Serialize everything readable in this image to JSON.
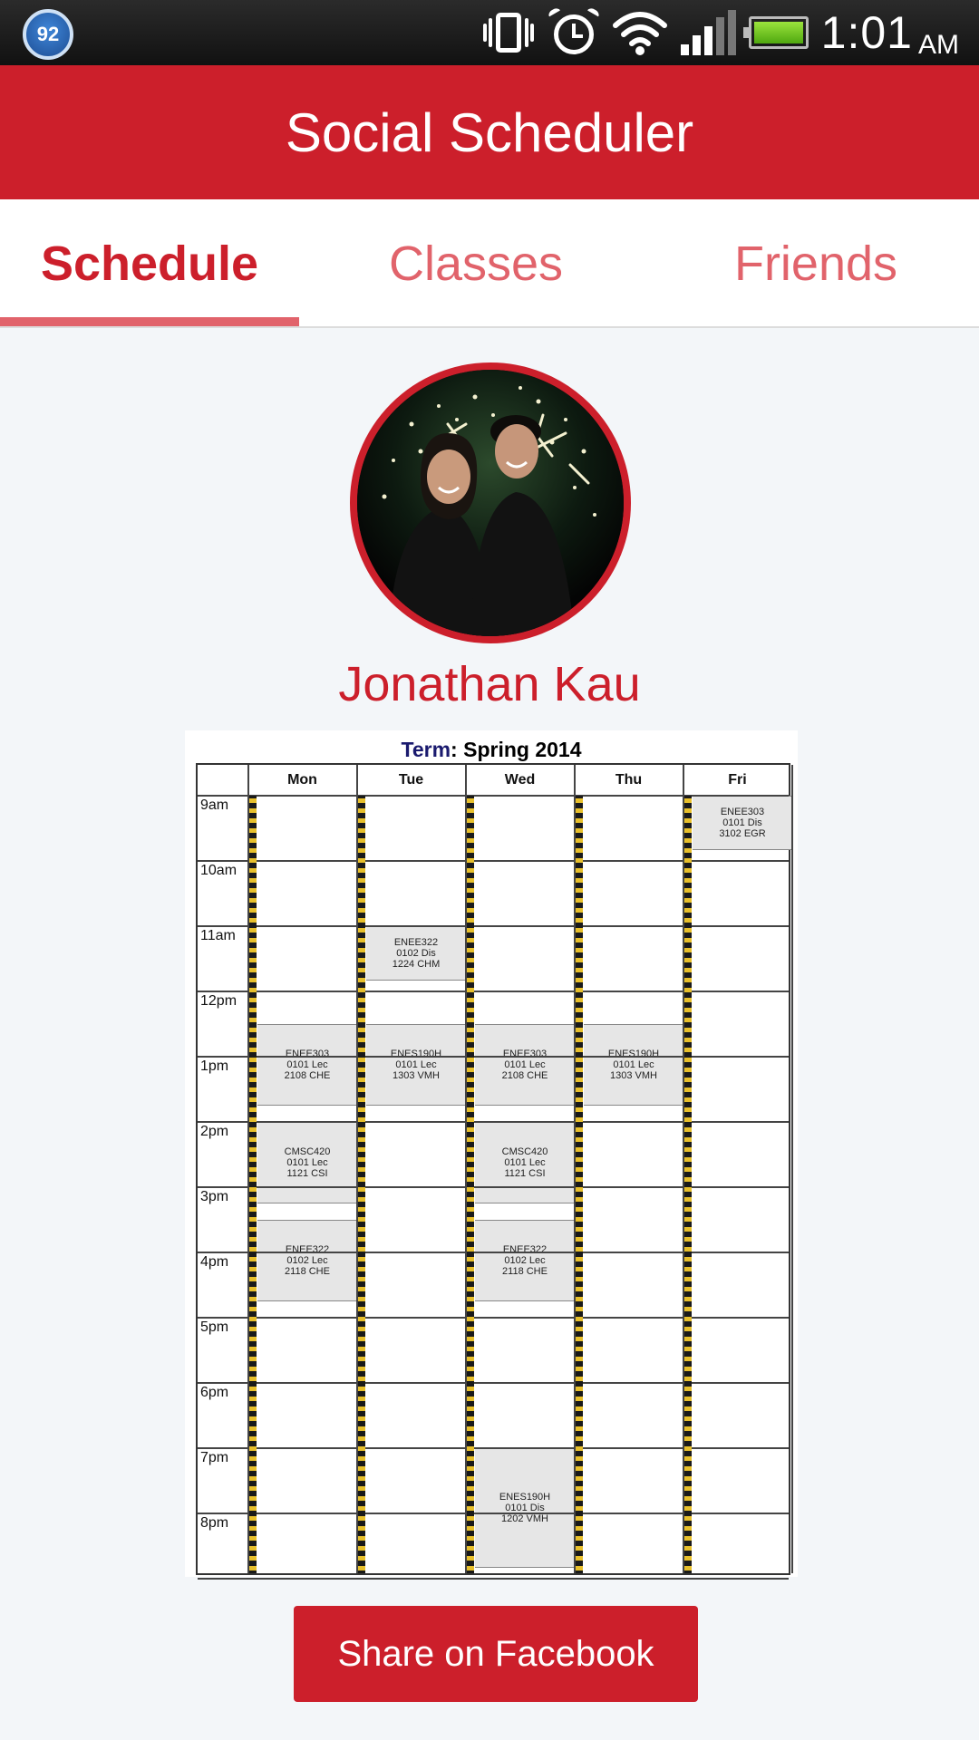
{
  "status_bar": {
    "badge": "92",
    "time": "1:01",
    "ampm": "AM",
    "icons": [
      "vibrate-icon",
      "alarm-icon",
      "wifi-icon",
      "signal-icon",
      "battery-icon"
    ]
  },
  "app": {
    "title": "Social Scheduler"
  },
  "tabs": [
    {
      "label": "Schedule",
      "active": true
    },
    {
      "label": "Classes",
      "active": false
    },
    {
      "label": "Friends",
      "active": false
    }
  ],
  "profile": {
    "name": "Jonathan Kau"
  },
  "schedule": {
    "term_label": "Term",
    "term_value": "Spring 2014",
    "days": [
      "Mon",
      "Tue",
      "Wed",
      "Thu",
      "Fri"
    ],
    "times": [
      "9am",
      "10am",
      "11am",
      "12pm",
      "1pm",
      "2pm",
      "3pm",
      "4pm",
      "5pm",
      "6pm",
      "7pm",
      "8pm"
    ],
    "blocks": [
      {
        "day": 4,
        "start": 9.0,
        "end": 9.83,
        "lines": [
          "ENEE303",
          "0101 Dis",
          "3102 EGR"
        ]
      },
      {
        "day": 1,
        "start": 11.0,
        "end": 11.83,
        "lines": [
          "ENEE322",
          "0102 Dis",
          "1224 CHM"
        ]
      },
      {
        "day": 0,
        "start": 12.5,
        "end": 13.75,
        "lines": [
          "ENEE303",
          "0101 Lec",
          "2108 CHE"
        ]
      },
      {
        "day": 1,
        "start": 12.5,
        "end": 13.75,
        "lines": [
          "ENES190H",
          "0101 Lec",
          "1303 VMH"
        ]
      },
      {
        "day": 2,
        "start": 12.5,
        "end": 13.75,
        "lines": [
          "ENEE303",
          "0101 Lec",
          "2108 CHE"
        ]
      },
      {
        "day": 3,
        "start": 12.5,
        "end": 13.75,
        "lines": [
          "ENES190H",
          "0101 Lec",
          "1303 VMH"
        ]
      },
      {
        "day": 0,
        "start": 14.0,
        "end": 15.25,
        "lines": [
          "CMSC420",
          "0101 Lec",
          "1121 CSI"
        ]
      },
      {
        "day": 2,
        "start": 14.0,
        "end": 15.25,
        "lines": [
          "CMSC420",
          "0101 Lec",
          "1121 CSI"
        ]
      },
      {
        "day": 0,
        "start": 15.5,
        "end": 16.75,
        "lines": [
          "ENEE322",
          "0102 Lec",
          "2118 CHE"
        ]
      },
      {
        "day": 2,
        "start": 15.5,
        "end": 16.75,
        "lines": [
          "ENEE322",
          "0102 Lec",
          "2118 CHE"
        ]
      },
      {
        "day": 2,
        "start": 19.0,
        "end": 20.83,
        "lines": [
          "ENES190H",
          "0101 Dis",
          "1202 VMH"
        ]
      }
    ]
  },
  "actions": {
    "share_label": "Share on Facebook"
  },
  "colors": {
    "primary": "#cc1f2b",
    "tab_inactive": "#e1636b",
    "background": "#f3f6f9"
  }
}
